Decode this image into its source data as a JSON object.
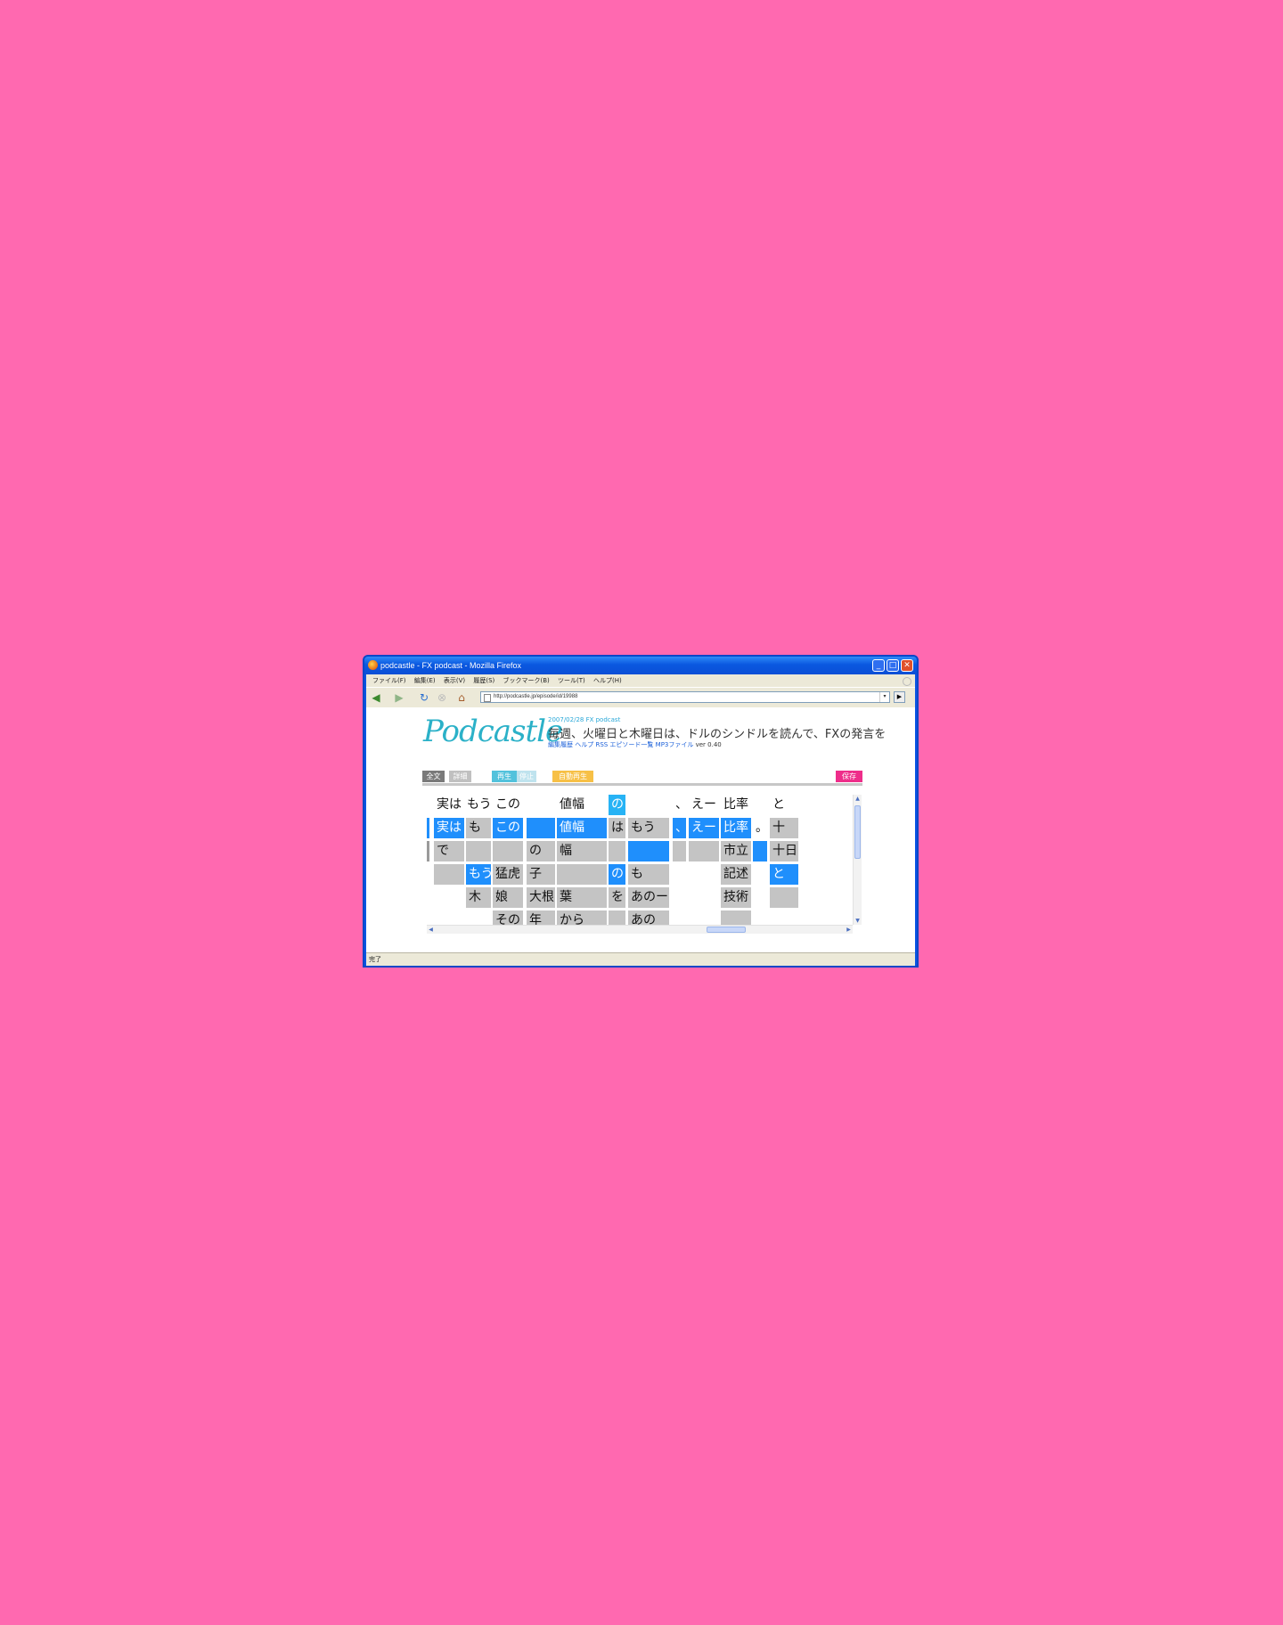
{
  "window": {
    "title": "podcastle - FX podcast - Mozilla Firefox",
    "btn_minimize": "_",
    "btn_maximize": "□",
    "btn_close": "✕"
  },
  "menu": [
    "ファイル(F)",
    "編集(E)",
    "表示(V)",
    "履歴(S)",
    "ブックマーク(B)",
    "ツール(T)",
    "ヘルプ(H)"
  ],
  "nav": {
    "back": "◀",
    "forward": "▶",
    "reload": "↻",
    "stop": "⊗",
    "home": "⌂",
    "url": "http://podcastle.jp/episode/id/19988",
    "go": "▶"
  },
  "page": {
    "logo": "Podcastle",
    "meta": "2007/02/28  FX podcast",
    "title": "毎週、火曜日と木曜日は、ドルのシンドルを読んで、FXの発言を",
    "links": "編集履歴 ヘルプ RSS エピソード一覧 MP3ファイル",
    "version": "ver 0.40",
    "tabs": {
      "all": "全文",
      "detail": "詳細",
      "play": "再生",
      "stop": "停止",
      "auto": "自動再生",
      "save": "保存"
    }
  },
  "transcript": {
    "headers": [
      "実は",
      "もう",
      "この",
      "値幅",
      "の",
      "、",
      "えー",
      "比率",
      "と"
    ],
    "row1": [
      "実は",
      "も",
      "この",
      "値幅",
      "は",
      "もう",
      "、",
      "えー",
      "比率",
      "。",
      "十"
    ],
    "row2": [
      "で",
      "の",
      "幅",
      "市立",
      "十日"
    ],
    "row3": [
      "もう",
      "猛虎",
      "子",
      "の",
      "も",
      "記述",
      "と"
    ],
    "row4": [
      "木",
      "娘",
      "大根",
      "葉",
      "を",
      "あのー",
      "技術"
    ],
    "row5": [
      "その",
      "年",
      "から",
      "あの"
    ]
  },
  "scrollbars": {
    "up": "▲",
    "down": "▼",
    "left": "◀",
    "right": "▶",
    "grip": "|||"
  },
  "status": {
    "text": "完了"
  },
  "colors": {
    "desktop": "#ff69b0",
    "highlight": "#1f8ffc",
    "candidate": "#c4c4c4",
    "save": "#ee2d8a"
  }
}
